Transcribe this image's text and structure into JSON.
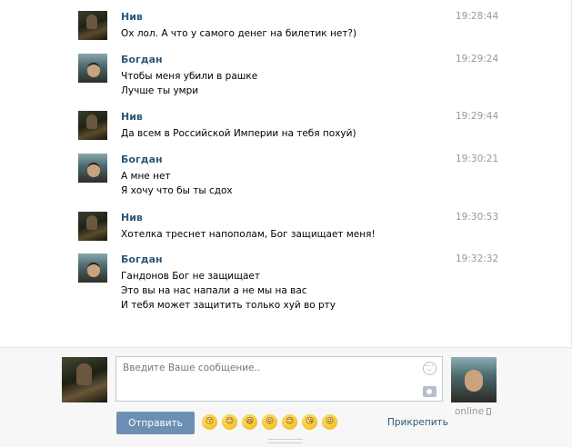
{
  "messages": [
    {
      "author": "Нив",
      "time": "19:28:44",
      "avatar": "niv",
      "lines": [
        "Ох лол. А что у самого денег на билетик нет?)"
      ]
    },
    {
      "author": "Богдан",
      "time": "19:29:24",
      "avatar": "bog",
      "lines": [
        "Чтобы меня убили в рашке",
        "Лучше ты умри"
      ]
    },
    {
      "author": "Нив",
      "time": "19:29:44",
      "avatar": "niv",
      "lines": [
        "Да всем в Российской Империи на тебя похуй)"
      ]
    },
    {
      "author": "Богдан",
      "time": "19:30:21",
      "avatar": "bog",
      "lines": [
        "А мне нет",
        "Я хочу что бы ты сдох"
      ]
    },
    {
      "author": "Нив",
      "time": "19:30:53",
      "avatar": "niv",
      "lines": [
        "Хотелка треснет напополам, Бог защищает меня!"
      ]
    },
    {
      "author": "Богдан",
      "time": "19:32:32",
      "avatar": "bog",
      "lines": [
        "Гандонов Бог не защищает",
        "Это вы на нас напали а не мы на вас",
        "И тебя может защитить только хуй во рту"
      ]
    }
  ],
  "composer": {
    "placeholder": "Введите Ваше сообщение..",
    "send_label": "Отправить",
    "attach_label": "Прикрепить",
    "online_label": "online",
    "emojis": [
      "😚",
      "😊",
      "😆",
      "😝",
      "😊",
      "😘",
      "😜"
    ]
  }
}
